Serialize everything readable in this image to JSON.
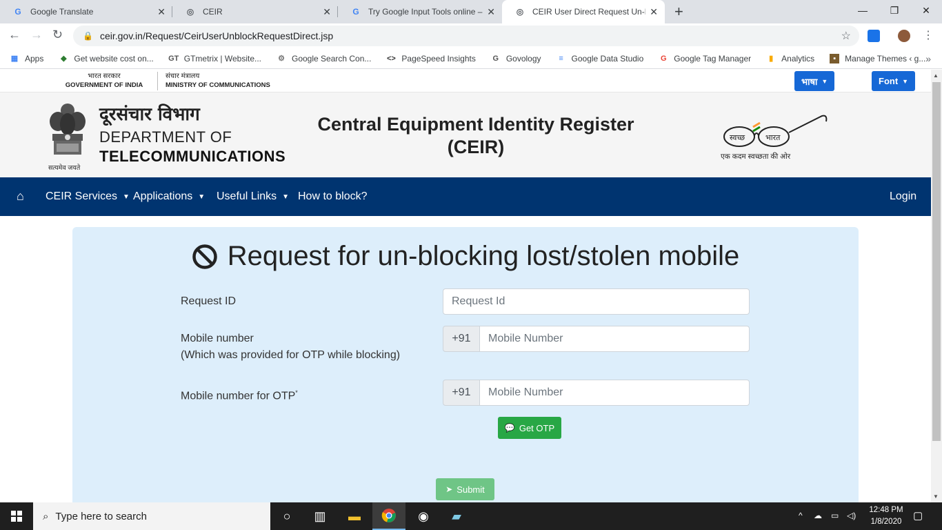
{
  "browser": {
    "tabs": [
      {
        "title": "Google Translate",
        "active": false
      },
      {
        "title": "CEIR",
        "active": false
      },
      {
        "title": "Try Google Input Tools online – G",
        "active": false
      },
      {
        "title": "CEIR User Direct Request Un-Blo",
        "active": true
      }
    ],
    "url": "ceir.gov.in/Request/CeirUserUnblockRequestDirect.jsp",
    "bookmarks": [
      {
        "label": "Apps",
        "icon": "apps-grid-icon"
      },
      {
        "label": "Get website cost on...",
        "icon": "tag-icon"
      },
      {
        "label": "GTmetrix | Website...",
        "icon": "gtmetrix-icon"
      },
      {
        "label": "Google Search Con...",
        "icon": "search-console-icon"
      },
      {
        "label": "PageSpeed Insights",
        "icon": "pagespeed-icon"
      },
      {
        "label": "Govology",
        "icon": "govology-icon"
      },
      {
        "label": "Google Data Studio",
        "icon": "data-studio-icon"
      },
      {
        "label": "Google Tag Manager",
        "icon": "google-g-icon"
      },
      {
        "label": "Analytics",
        "icon": "analytics-icon"
      },
      {
        "label": "Manage Themes ‹ g...",
        "icon": "theme-icon"
      }
    ]
  },
  "site": {
    "gov_hi": "भारत सरकार",
    "gov_en": "GOVERNMENT OF INDIA",
    "ministry_hi": "संचार मंत्रालय",
    "ministry_en": "MINISTRY OF COMMUNICATIONS",
    "lang_button": "भाषा",
    "font_button": "Font",
    "dept_hi": "दूरसंचार विभाग",
    "dept_en1": "DEPARTMENT OF",
    "dept_en2": "TELECOMMUNICATIONS",
    "emblem_caption": "सत्यमेव जयते",
    "title_line1": "Central Equipment Identity Register",
    "title_line2": "(CEIR)",
    "swachh_left": "स्वच्छ",
    "swachh_right": "भारत",
    "swachh_caption": "एक कदम स्वच्छता की ओर"
  },
  "nav": {
    "items": [
      {
        "label": "CEIR Services",
        "dropdown": true
      },
      {
        "label": "Applications",
        "dropdown": true
      },
      {
        "label": "Useful Links",
        "dropdown": true
      },
      {
        "label": "How to block?",
        "dropdown": false
      }
    ],
    "login": "Login"
  },
  "form": {
    "title": "Request for un-blocking lost/stolen mobile",
    "request_id_label": "Request ID",
    "request_id_placeholder": "Request Id",
    "mobile_label": "Mobile number",
    "mobile_sublabel": "(Which was provided for OTP while blocking)",
    "mobile_prefix": "+91",
    "mobile_placeholder": "Mobile Number",
    "otp_mobile_label": "Mobile number for OTP",
    "otp_mobile_mark": "*",
    "otp_prefix": "+91",
    "otp_placeholder": "Mobile Number",
    "get_otp": "Get OTP",
    "submit": "Submit"
  },
  "taskbar": {
    "search_placeholder": "Type here to search",
    "time": "12:48 PM",
    "date": "1/8/2020"
  },
  "colors": {
    "navbar": "#003470",
    "card_bg": "#ddeefb",
    "green": "#28a745",
    "blue_button": "#1668d6"
  }
}
